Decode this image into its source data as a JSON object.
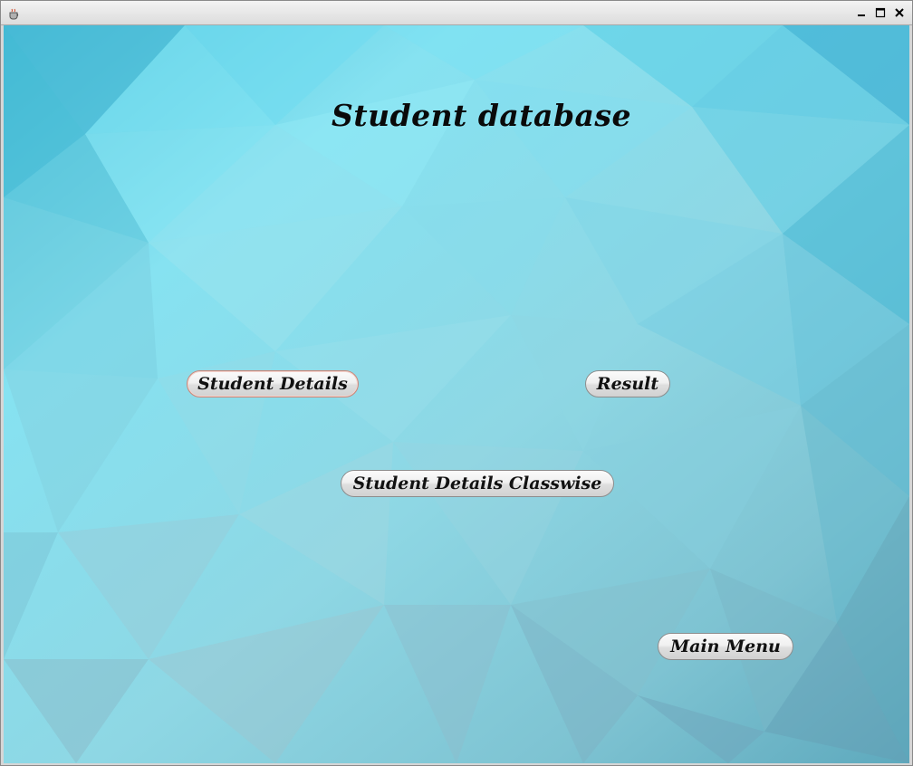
{
  "window": {
    "icon": "java-cup-icon",
    "controls": [
      "minimize-icon",
      "maximize-icon",
      "close-icon"
    ]
  },
  "page": {
    "title": "Student database"
  },
  "buttons": {
    "student_details": "Student Details",
    "result": "Result",
    "student_details_classwise": "Student Details Classwise",
    "main_menu": "Main Menu"
  },
  "colors": {
    "background_light": "#8fe6f3",
    "background_dark": "#5fb3c8",
    "focus_border": "#c9877a"
  }
}
